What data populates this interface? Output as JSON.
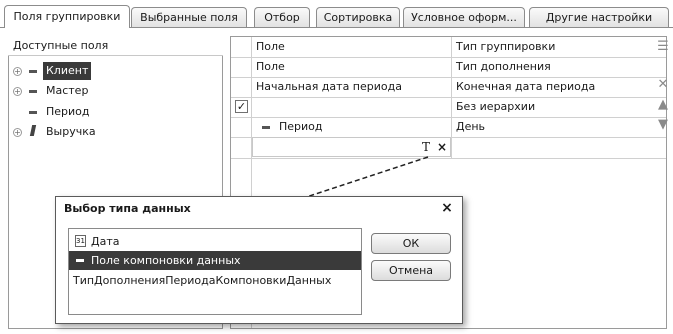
{
  "tabs": [
    {
      "label": "Поля группировки",
      "active": true
    },
    {
      "label": "Выбранные поля",
      "active": false
    },
    {
      "label": "Отбор",
      "active": false
    },
    {
      "label": "Сортировка",
      "active": false
    },
    {
      "label": "Условное оформ...",
      "active": false
    },
    {
      "label": "Другие настройки",
      "active": false
    }
  ],
  "left_panel": {
    "header": "Доступные поля",
    "items": [
      {
        "label": "Клиент",
        "expandable": true,
        "selected": true,
        "icon": "field-dash-icon"
      },
      {
        "label": "Мастер",
        "expandable": true,
        "selected": false,
        "icon": "field-dash-icon"
      },
      {
        "label": "Период",
        "expandable": false,
        "selected": false,
        "icon": "field-dash-icon"
      },
      {
        "label": "Выручка",
        "expandable": true,
        "selected": false,
        "icon": "measure-icon"
      }
    ]
  },
  "grid": {
    "headers": [
      {
        "col1": "Поле",
        "col2": "Тип группировки"
      },
      {
        "col1": "Поле",
        "col2": "Тип дополнения"
      },
      {
        "col1": "Начальная дата периода",
        "col2": "Конечная дата периода"
      }
    ],
    "rows": [
      {
        "col1": "",
        "col2": "Без иерархии",
        "checked": true
      },
      {
        "col1": "Период",
        "col2": "День",
        "checked": false
      }
    ],
    "edit_cell_buttons": [
      "T",
      "×"
    ]
  },
  "side_toolbar": [
    "group-add-icon",
    "delete-icon",
    "move-up-icon",
    "move-down-icon"
  ],
  "dialog": {
    "title": "Выбор типа данных",
    "list_items": [
      {
        "label": "Дата",
        "icon": "calendar-icon",
        "icon_text": "31",
        "selected": false
      },
      {
        "label": "Поле компоновки данных",
        "icon": "field-dash-icon",
        "selected": true
      },
      {
        "label": "ТипДополненияПериодаКомпоновкиДанных",
        "icon": "",
        "selected": false
      }
    ],
    "ok_label": "ОК",
    "cancel_label": "Отмена"
  }
}
